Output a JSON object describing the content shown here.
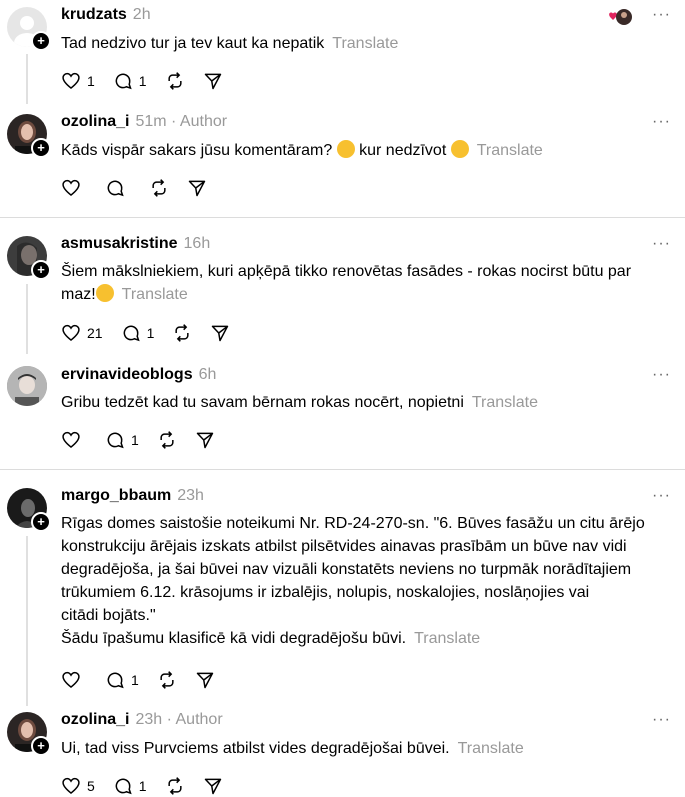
{
  "posts": [
    {
      "username": "krudzats",
      "time": "2h",
      "author": "",
      "text": "Tad nedzivo tur ja tev kaut ka nepatik",
      "translate": "Translate",
      "likes": "1",
      "replies": "1",
      "more": "···"
    },
    {
      "username": "ozolina_i",
      "time": "51m",
      "author": "· Author",
      "text_parts": [
        "Kāds vispār sakars jūsu komentāram? ",
        " kur nedzīvot "
      ],
      "translate": "Translate",
      "likes": "",
      "replies": "",
      "more": "···"
    },
    {
      "username": "asmusakristine",
      "time": "16h",
      "author": "",
      "text_parts": [
        "Šiem mākslniekiem, kuri apķēpā tikko renovētas fasādes - rokas nocirst būtu par\nmaz!"
      ],
      "translate": "Translate",
      "likes": "21",
      "replies": "1",
      "more": "···"
    },
    {
      "username": "ervinavideoblogs",
      "time": "6h",
      "author": "",
      "text": "Gribu tedzēt kad tu savam bērnam rokas nocērt, nopietni",
      "translate": "Translate",
      "likes": "",
      "replies": "1",
      "more": "···"
    },
    {
      "username": "margo_bbaum",
      "time": "23h",
      "author": "",
      "text": "Rīgas domes saistošie noteikumi Nr. RD-24-270-sn. \"6. Būves fasāžu un citu ārējo\nkonstrukciju ārējais izskats atbilst pilsētvides ainavas prasībām un būve nav vidi\ndegradējoša, ja šai būvei nav vizuāli konstatēts neviens no turpmāk norādītajiem\ntrūkumiem 6.12. krāsojums ir izbalējis, nolupis, noskalojies, noslāņojies vai\ncitādi bojāts.\"\nŠādu īpašumu klasificē kā vidi degradējošu būvi.",
      "translate": "Translate",
      "likes": "",
      "replies": "1",
      "more": "···"
    },
    {
      "username": "ozolina_i",
      "time": "23h",
      "author": "· Author",
      "text": "Ui, tad viss Purvciems atbilst vides degradējošai būvei.",
      "translate": "Translate",
      "likes": "5",
      "replies": "1",
      "more": "···"
    }
  ],
  "colors": {
    "muted": "#999999",
    "divider": "#dcdcdc",
    "heart": "#e0245e"
  }
}
